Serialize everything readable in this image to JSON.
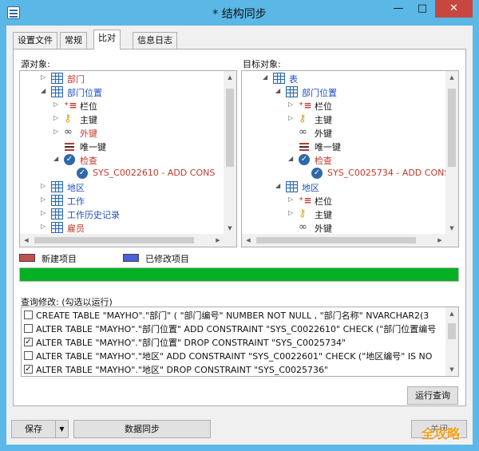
{
  "window": {
    "title": "* 结构同步",
    "buttons": {
      "minimize": "—",
      "maximize": "□",
      "close": "✕"
    }
  },
  "tabs": [
    {
      "label": "设置文件",
      "active": false
    },
    {
      "label": "常规",
      "active": false
    },
    {
      "label": "比对",
      "active": true
    },
    {
      "label": "信息日志",
      "active": false
    }
  ],
  "source": {
    "label": "源对象:",
    "tree": [
      {
        "level": 0,
        "expander": "▷",
        "icon": "table-icon",
        "text": "部门",
        "color": "red"
      },
      {
        "level": 0,
        "expander": "◢",
        "icon": "table-icon",
        "text": "部门位置",
        "color": "blue"
      },
      {
        "level": 1,
        "expander": "▷",
        "icon": "columns-icon",
        "text": "栏位",
        "color": "black"
      },
      {
        "level": 1,
        "expander": "▷",
        "icon": "key-icon",
        "text": "主键",
        "color": "black"
      },
      {
        "level": 1,
        "expander": "▷",
        "icon": "link-icon",
        "text": "外键",
        "color": "red"
      },
      {
        "level": 1,
        "expander": "",
        "icon": "unique-icon",
        "text": "唯一键",
        "color": "black"
      },
      {
        "level": 1,
        "expander": "◢",
        "icon": "check-icon",
        "text": "检查",
        "color": "red"
      },
      {
        "level": 2,
        "expander": "",
        "icon": "check-icon",
        "text": "SYS_C0022610 - ADD CONS",
        "color": "red"
      },
      {
        "level": 0,
        "expander": "▷",
        "icon": "table-icon",
        "text": "地区",
        "color": "blue"
      },
      {
        "level": 0,
        "expander": "▷",
        "icon": "table-icon",
        "text": "工作",
        "color": "blue"
      },
      {
        "level": 0,
        "expander": "▷",
        "icon": "table-icon",
        "text": "工作历史记录",
        "color": "blue"
      },
      {
        "level": 0,
        "expander": "▷",
        "icon": "table-icon",
        "text": "雇员",
        "color": "red"
      }
    ]
  },
  "target": {
    "label": "目标对象:",
    "tree": [
      {
        "level": 0,
        "expander": "◢",
        "icon": "table-icon",
        "text": "表",
        "color": "blue"
      },
      {
        "level": 1,
        "expander": "◢",
        "icon": "table-icon",
        "text": "部门位置",
        "color": "blue"
      },
      {
        "level": 2,
        "expander": "▷",
        "icon": "columns-icon",
        "text": "栏位",
        "color": "black"
      },
      {
        "level": 2,
        "expander": "▷",
        "icon": "key-icon",
        "text": "主键",
        "color": "black"
      },
      {
        "level": 2,
        "expander": "",
        "icon": "link-icon",
        "text": "外键",
        "color": "black"
      },
      {
        "level": 2,
        "expander": "",
        "icon": "unique-icon",
        "text": "唯一键",
        "color": "black"
      },
      {
        "level": 2,
        "expander": "◢",
        "icon": "check-icon",
        "text": "检查",
        "color": "red"
      },
      {
        "level": 3,
        "expander": "",
        "icon": "check-icon",
        "text": "SYS_C0025734 - ADD CONS",
        "color": "red"
      },
      {
        "level": 1,
        "expander": "◢",
        "icon": "table-icon",
        "text": "地区",
        "color": "blue"
      },
      {
        "level": 2,
        "expander": "▷",
        "icon": "columns-icon",
        "text": "栏位",
        "color": "black"
      },
      {
        "level": 2,
        "expander": "▷",
        "icon": "key-icon",
        "text": "主键",
        "color": "black"
      },
      {
        "level": 2,
        "expander": "",
        "icon": "link-icon",
        "text": "外键",
        "color": "black"
      }
    ]
  },
  "legend": {
    "new_label": "新建项目",
    "new_color": "#c0504d",
    "modified_label": "已修改项目",
    "modified_color": "#4a5fd8"
  },
  "progress": {
    "percent": 100,
    "color": "#06b025"
  },
  "query": {
    "label": "查询修改: (勾选以运行)",
    "rows": [
      {
        "checked": false,
        "text": "CREATE TABLE \"MAYHO\".\"部门\" ( \"部门编号\" NUMBER NOT NULL , \"部门名称\" NVARCHAR2(3"
      },
      {
        "checked": false,
        "text": "ALTER TABLE \"MAYHO\".\"部门位置\" ADD CONSTRAINT \"SYS_C0022610\" CHECK (\"部门位置编号"
      },
      {
        "checked": true,
        "text": "ALTER TABLE \"MAYHO\".\"部门位置\" DROP CONSTRAINT \"SYS_C0025734\""
      },
      {
        "checked": false,
        "text": "ALTER TABLE \"MAYHO\".\"地区\" ADD CONSTRAINT \"SYS_C0022601\" CHECK (\"地区编号\" IS NO"
      },
      {
        "checked": true,
        "text": "ALTER TABLE \"MAYHO\".\"地区\" DROP CONSTRAINT \"SYS_C0025736\""
      }
    ],
    "run_button": "运行查询"
  },
  "footer": {
    "save_button": "保存",
    "sync_button": "数据同步",
    "close_button": "关闭"
  },
  "watermark": "全攻略"
}
